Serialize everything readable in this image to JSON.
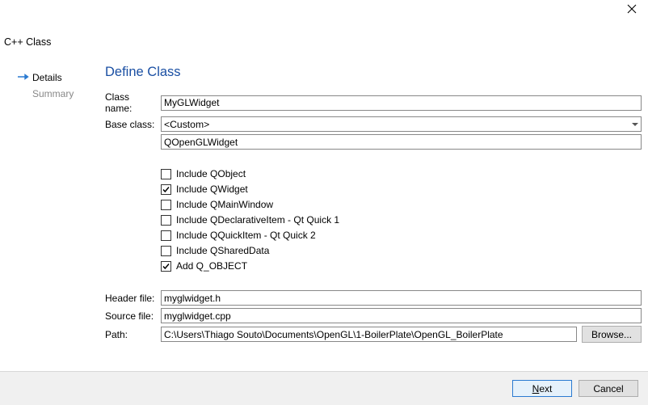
{
  "window": {
    "title": "C++ Class"
  },
  "sidebar": {
    "items": [
      {
        "label": "Details",
        "active": true
      },
      {
        "label": "Summary",
        "active": false
      }
    ]
  },
  "main": {
    "heading": "Define Class",
    "labels": {
      "class_name": "Class name:",
      "base_class": "Base class:",
      "header_file": "Header file:",
      "source_file": "Source file:",
      "path": "Path:",
      "browse": "Browse..."
    },
    "values": {
      "class_name": "MyGLWidget",
      "base_class_selected": "<Custom>",
      "base_class_custom": "QOpenGLWidget",
      "header_file": "myglwidget.h",
      "source_file": "myglwidget.cpp",
      "path": "C:\\Users\\Thiago Souto\\Documents\\OpenGL\\1-BoilerPlate\\OpenGL_BoilerPlate"
    },
    "checkboxes": [
      {
        "label": "Include QObject",
        "checked": false
      },
      {
        "label": "Include QWidget",
        "checked": true
      },
      {
        "label": "Include QMainWindow",
        "checked": false
      },
      {
        "label": "Include QDeclarativeItem - Qt Quick 1",
        "checked": false
      },
      {
        "label": "Include QQuickItem - Qt Quick 2",
        "checked": false
      },
      {
        "label": "Include QSharedData",
        "checked": false
      },
      {
        "label": "Add Q_OBJECT",
        "checked": true
      }
    ]
  },
  "footer": {
    "next": "Next",
    "cancel": "Cancel"
  }
}
